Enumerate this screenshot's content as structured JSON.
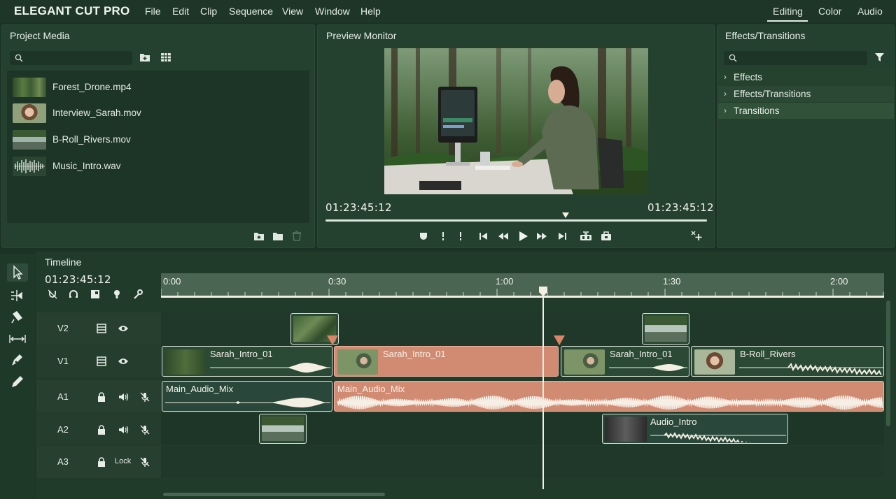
{
  "app": {
    "title": "ELEGANT CUT PRO"
  },
  "menu": [
    "File",
    "Edit",
    "Clip",
    "Sequence",
    "View",
    "Window",
    "Help"
  ],
  "workspaces": {
    "items": [
      "Editing",
      "Color",
      "Audio"
    ],
    "active": "Editing"
  },
  "project_media": {
    "title": "Project Media",
    "items": [
      {
        "name": "Forest_Drone.mp4",
        "thumb": "forest-thumb"
      },
      {
        "name": "Interview_Sarah.mov",
        "thumb": "portrait-thumb"
      },
      {
        "name": "B-Roll_Rivers.mov",
        "thumb": "river-thumb"
      },
      {
        "name": "Music_Intro.wav",
        "thumb": "waveform-thumb"
      }
    ]
  },
  "preview": {
    "title": "Preview Monitor",
    "current_timecode": "01:23:45:12",
    "duration_timecode": "01:23:45:12",
    "scrub_position": 0.63
  },
  "effects": {
    "title": "Effects/Transitions",
    "items": [
      "Effects",
      "Effects/Transitions",
      "Transitions"
    ],
    "highlighted": "Transitions"
  },
  "timeline": {
    "title": "Timeline",
    "timecode": "01:23:45:12",
    "ruler_marks": [
      "0:00",
      "0:30",
      "1:00",
      "1:30",
      "2:00"
    ],
    "tracks": [
      {
        "name": "V2"
      },
      {
        "name": "V1"
      },
      {
        "name": "A1"
      },
      {
        "name": "A2"
      },
      {
        "name": "A3",
        "lock_text": "Lock"
      }
    ],
    "clips": {
      "v1_a": "Sarah_Intro_01",
      "v1_b": "Sarah_Intro_01",
      "v1_c": "Sarah_Intro_01",
      "v1_d": "B-Roll_Rivers",
      "a1_a": "Main_Audio_Mix",
      "a1_b": "Main_Audio_Mix",
      "a2_a": "Audio_Intro"
    }
  },
  "colors": {
    "background": "#1b3325",
    "panel": "#24402e",
    "selected_clip": "#d28b73",
    "marker": "#d98567",
    "accent_text": "#f3efe2"
  }
}
